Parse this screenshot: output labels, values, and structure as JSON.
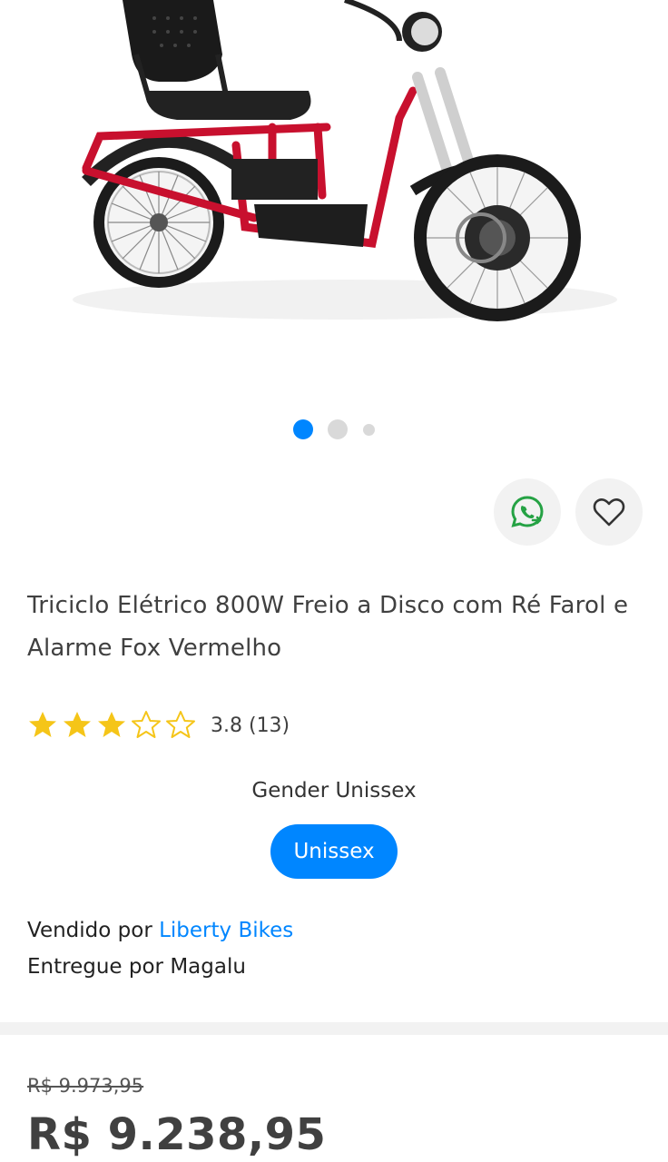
{
  "product": {
    "title": "Triciclo Elétrico 800W Freio a Disco com Ré Farol e Alarme Fox Vermelho",
    "image_icon": "electric-tricycle-image",
    "carousel": {
      "total": 3,
      "active": 1
    },
    "rating": {
      "value": 3.8,
      "text": "3.8 (13)",
      "stars_max": 5
    },
    "variant": {
      "label": "Gender Unissex",
      "options": [
        "Unissex"
      ],
      "selected": "Unissex"
    },
    "seller": {
      "sold_prefix": "Vendido por",
      "sold_by": "Liberty Bikes",
      "delivered_prefix": "Entregue por",
      "delivered_by": "Magalu"
    },
    "price": {
      "old": "R$ 9.973,95",
      "current": "R$ 9.238,95"
    }
  },
  "actions": {
    "share_icon": "whatsapp-icon",
    "favorite_icon": "heart-icon"
  },
  "colors": {
    "accent": "#0086ff",
    "whatsapp": "#25a244",
    "star": "#f5c518",
    "frame_red": "#c8102e"
  }
}
